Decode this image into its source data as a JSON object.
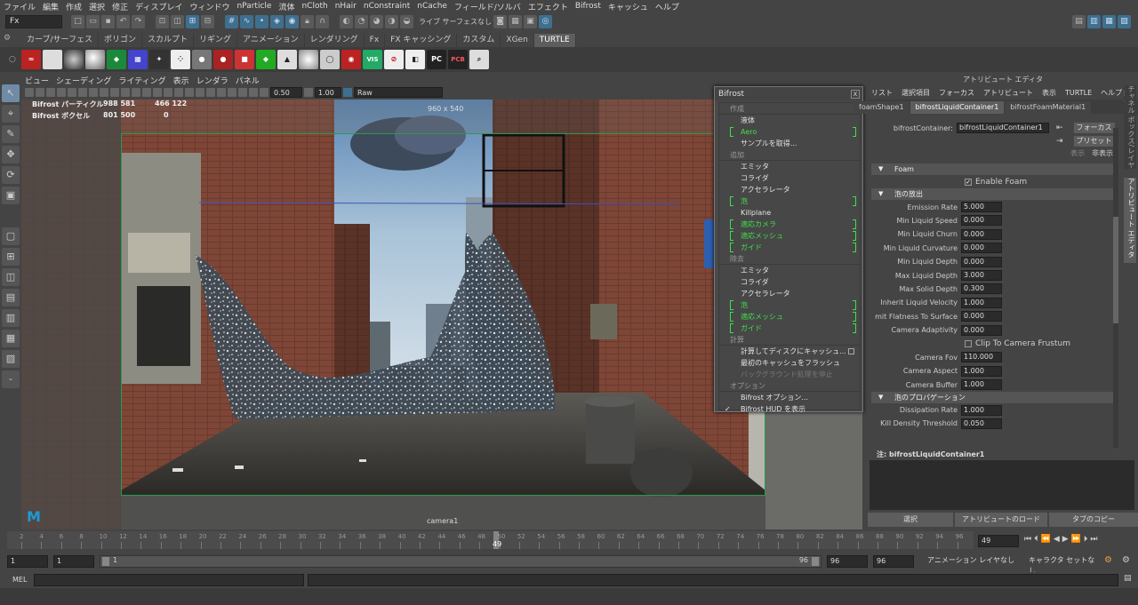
{
  "menubar": [
    "ファイル",
    "編集",
    "作成",
    "選択",
    "修正",
    "ディスプレイ",
    "ウィンドウ",
    "nParticle",
    "流体",
    "nCloth",
    "nHair",
    "nConstraint",
    "nCache",
    "フィールド/ソルバ",
    "エフェクト",
    "Bifrost",
    "キャッシュ",
    "ヘルプ"
  ],
  "statusline": {
    "mode": "Fx",
    "snap_label": "ライブ サーフェスなし"
  },
  "shelf_tabs": [
    "カーブ/サーフェス",
    "ポリゴン",
    "スカルプト",
    "リギング",
    "アニメーション",
    "レンダリング",
    "Fx",
    "FX キャッシング",
    "カスタム",
    "XGen",
    "TURTLE"
  ],
  "shelf_active": "TURTLE",
  "shelf_icon_labels": [
    "VIS",
    "PC",
    "PCB",
    "HW"
  ],
  "viewport": {
    "menu": [
      "ビュー",
      "シェーディング",
      "ライティング",
      "表示",
      "レンダラ",
      "パネル"
    ],
    "near": "0.50",
    "far": "1.00",
    "colorspace": "Raw",
    "hud": {
      "r1_label": "Bifrost パーティクル",
      "r1_v1": "988 581",
      "r1_v2": "466 122",
      "r2_label": "Bifrost ボクセル",
      "r2_v1": "801 500",
      "r2_v2": "0"
    },
    "resolution": "960 x 540",
    "camera": "camera1"
  },
  "bifrost_menu": {
    "title": "Bifrost",
    "close": "x",
    "h_create": "作成",
    "liquid": "液体",
    "aero": "Aero",
    "sample": "サンプルを取得...",
    "h_add": "追加",
    "add_emitter": "エミッタ",
    "add_collider": "コライダ",
    "add_accel": "アクセラレータ",
    "add_foam": "泡",
    "add_kill": "Killplane",
    "add_adaptcam": "適応カメラ",
    "add_adaptmesh": "適応メッシュ",
    "add_guide": "ガイド",
    "h_remove": "除去",
    "rm_emitter": "エミッタ",
    "rm_collider": "コライダ",
    "rm_accel": "アクセラレータ",
    "rm_foam": "泡",
    "rm_adaptmesh": "適応メッシュ",
    "rm_guide": "ガイド",
    "h_compute": "計算",
    "compute_cache": "計算してディスクにキャッシュ...",
    "flush": "最初のキャッシュをフラッシュ",
    "stop_bg": "バックグラウンド処理を停止",
    "h_options": "オプション",
    "options": "Bifrost オプション...",
    "show_hud": "Bifrost HUD を表示"
  },
  "attribute_editor": {
    "title": "アトリビュート エディタ",
    "menu": [
      "リスト",
      "選択項目",
      "フォーカス",
      "アトリビュート",
      "表示",
      "TURTLE",
      "ヘルプ"
    ],
    "tabs": [
      "foamShape1",
      "bifrostLiquidContainer1",
      "bifrostFoamMaterial1"
    ],
    "active_tab": "bifrostLiquidContainer1",
    "container_label": "bifrostContainer:",
    "container_value": "bifrostLiquidContainer1",
    "focus_btn": "フォーカス",
    "preset_btn": "プリセット",
    "show": "表示",
    "hide": "非表示",
    "sec_foam": "Foam",
    "enable_foam": "Enable Foam",
    "sec_emit": "泡の放出",
    "fields": [
      {
        "label": "Emission Rate",
        "value": "5.000"
      },
      {
        "label": "Min Liquid Speed",
        "value": "0.000"
      },
      {
        "label": "Min Liquid Churn",
        "value": "0.000"
      },
      {
        "label": "Min Liquid Curvature",
        "value": "0.000"
      },
      {
        "label": "Min Liquid Depth",
        "value": "0.000"
      },
      {
        "label": "Max Liquid Depth",
        "value": "3.000"
      },
      {
        "label": "Max Solid Depth",
        "value": "0.300"
      },
      {
        "label": "Inherit Liquid Velocity",
        "value": "1.000"
      },
      {
        "label": "mit Flatness To Surface",
        "value": "0.000"
      },
      {
        "label": "Camera Adaptivity",
        "value": "0.000"
      }
    ],
    "clip_frustum": "Clip To Camera Frustum",
    "fields2": [
      {
        "label": "Camera Fov",
        "value": "110.000"
      },
      {
        "label": "Camera Aspect",
        "value": "1.000"
      },
      {
        "label": "Camera Buffer",
        "value": "1.000"
      }
    ],
    "sec_prop": "泡のプロパゲーション",
    "fields3": [
      {
        "label": "Dissipation Rate",
        "value": "1.000"
      },
      {
        "label": "Kill Density Threshold",
        "value": "0.050"
      }
    ],
    "notes_label": "注: bifrostLiquidContainer1",
    "btn_select": "選択",
    "btn_load": "アトリビュートのロード",
    "btn_copy": "タブのコピー",
    "side_tabs": [
      "チャネル ボックス/レイヤ エディタ",
      "アトリビュート エディタ"
    ]
  },
  "timeline": {
    "ticks": [
      "2",
      "4",
      "6",
      "8",
      "10",
      "12",
      "14",
      "16",
      "18",
      "20",
      "22",
      "24",
      "26",
      "28",
      "30",
      "32",
      "34",
      "36",
      "38",
      "40",
      "42",
      "44",
      "46",
      "48",
      "50",
      "52",
      "54",
      "56",
      "58",
      "60",
      "62",
      "64",
      "66",
      "68",
      "70",
      "72",
      "74",
      "76",
      "78",
      "80",
      "82",
      "84",
      "86",
      "88",
      "90",
      "92",
      "94",
      "96"
    ],
    "current": "49",
    "current_field": "49"
  },
  "range": {
    "start": "1",
    "start2": "1",
    "slider_left": "1",
    "slider_right": "96",
    "end": "96",
    "end2": "96",
    "anim_layer": "アニメーション レイヤなし",
    "char_set": "キャラクタ セットなし"
  },
  "command": {
    "label": "MEL"
  }
}
